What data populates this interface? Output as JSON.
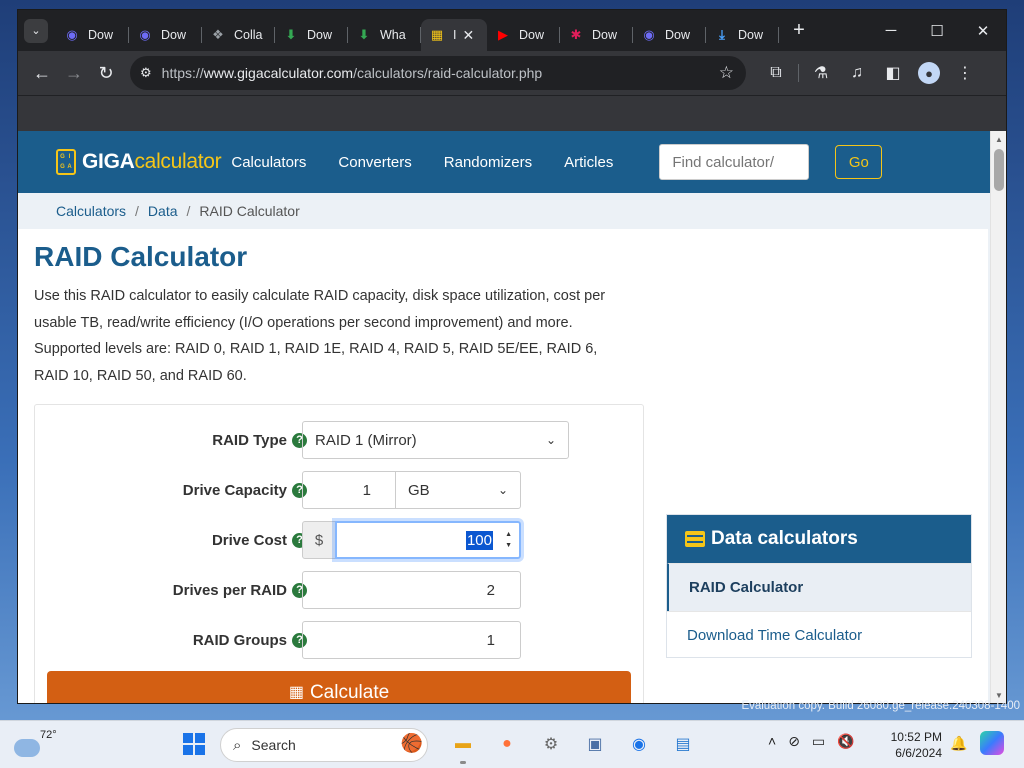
{
  "browser": {
    "tabs": [
      {
        "label": "Dow",
        "icon": "chrome-logo-icon",
        "color": "#6e6cf6"
      },
      {
        "label": "Dow",
        "icon": "chrome-logo-icon",
        "color": "#6e6cf6"
      },
      {
        "label": "Colla",
        "icon": "collab-icon",
        "color": "#9aa0a6"
      },
      {
        "label": "Dow",
        "icon": "download-arrow-icon",
        "color": "#34a853"
      },
      {
        "label": "Wha",
        "icon": "download-arrow-icon",
        "color": "#34a853"
      },
      {
        "label": "I",
        "icon": "calculator-favicon-icon",
        "color": "#f5c518",
        "active": true
      },
      {
        "label": "Dow",
        "icon": "youtube-icon",
        "color": "#ff0000"
      },
      {
        "label": "Dow",
        "icon": "slack-icon",
        "color": "#e01e5a"
      },
      {
        "label": "Dow",
        "icon": "chrome-logo-icon",
        "color": "#6e6cf6"
      },
      {
        "label": "Dow",
        "icon": "download-icon",
        "color": "#4aa3ff"
      }
    ],
    "url_prefix": "https://",
    "url_host": "www.gigacalculator.com",
    "url_path": "/calculators/raid-calculator.php"
  },
  "site": {
    "logo_giga": "GIGA",
    "logo_calc": "calculator",
    "nav": [
      "Calculators",
      "Converters",
      "Randomizers",
      "Articles"
    ],
    "search_placeholder": "Find calculator/",
    "go_label": "Go",
    "brand_color": "#1b5d8c",
    "accent_color": "#f5c518"
  },
  "breadcrumb": {
    "items": [
      "Calculators",
      "Data"
    ],
    "current": "RAID Calculator"
  },
  "page": {
    "title": "RAID Calculator",
    "intro": "Use this RAID calculator to easily calculate RAID capacity, disk space utilization, cost per usable TB, read/write efficiency (I/O operations per second improvement) and more. Supported levels are: RAID 0, RAID 1, RAID 1E, RAID 4, RAID 5, RAID 5E/EE, RAID 6, RAID 10, RAID 50, and RAID 60."
  },
  "form": {
    "raid_type_label": "RAID Type",
    "raid_type_value": "RAID 1 (Mirror)",
    "drive_capacity_label": "Drive Capacity",
    "drive_capacity_value": "1",
    "drive_capacity_unit": "GB",
    "drive_cost_label": "Drive Cost",
    "drive_cost_prefix": "$",
    "drive_cost_value": "100",
    "drives_per_raid_label": "Drives per RAID",
    "drives_per_raid_value": "2",
    "raid_groups_label": "RAID Groups",
    "raid_groups_value": "1",
    "help_glyph": "?",
    "calculate_label": "Calculate",
    "calculate_color": "#d35f13"
  },
  "sidebar": {
    "title": "Data calculators",
    "items": [
      {
        "label": "RAID Calculator",
        "active": true
      },
      {
        "label": "Download Time Calculator",
        "active": false
      }
    ]
  },
  "desktop": {
    "watermark": "Evaluation copy. Build 26080.ge_release.240308-1400"
  },
  "taskbar": {
    "temperature": "72°",
    "search_label": "Search",
    "time": "10:52 PM",
    "date": "6/6/2024"
  }
}
